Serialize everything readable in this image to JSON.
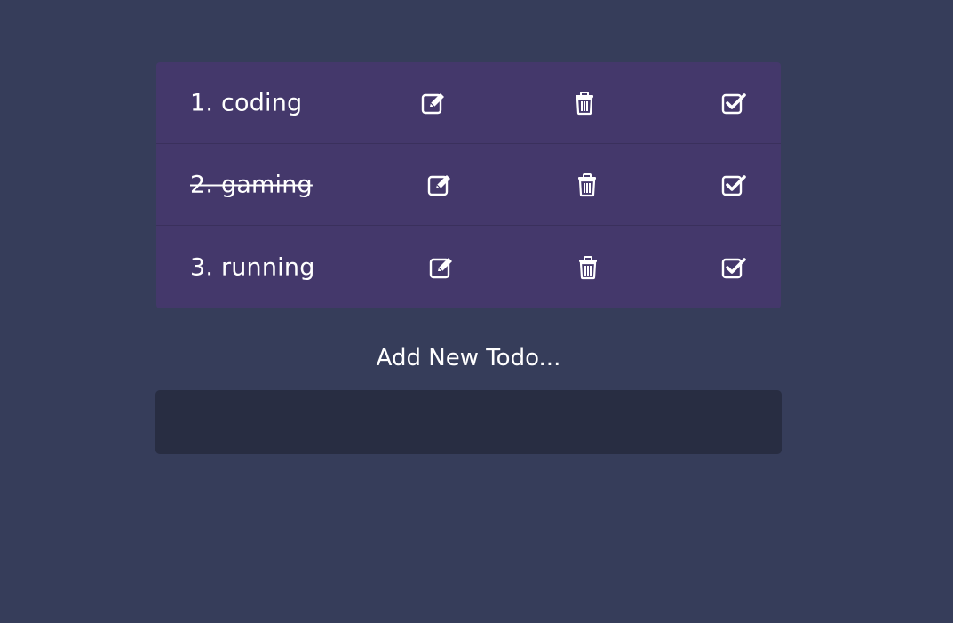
{
  "todos": [
    {
      "label": "1. coding",
      "completed": false
    },
    {
      "label": "2. gaming",
      "completed": true
    },
    {
      "label": "3. running",
      "completed": false
    }
  ],
  "icons": {
    "edit": "pen-square-icon",
    "delete": "trash-icon",
    "complete": "check-square-icon"
  },
  "add_form": {
    "label": "Add New Todo...",
    "input_value": "",
    "input_placeholder": ""
  },
  "colors": {
    "background": "#363d5a",
    "card": "#44386b",
    "input": "#282d42",
    "text": "#ffffff"
  }
}
